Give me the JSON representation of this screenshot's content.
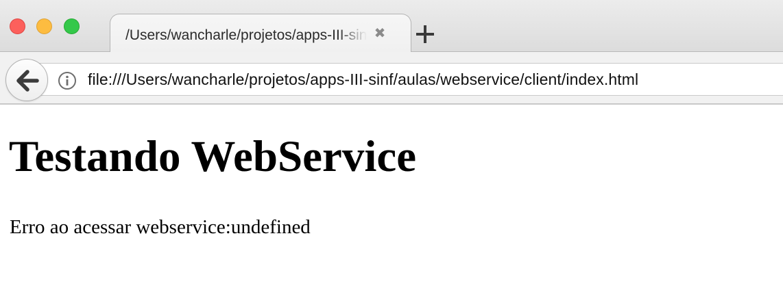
{
  "browser": {
    "tab": {
      "title": "/Users/wancharle/projetos/apps-III-sinf/aulas/webservice/client/index.html",
      "close_glyph": "✖"
    },
    "url": "file:///Users/wancharle/projetos/apps-III-sinf/aulas/webservice/client/index.html",
    "icons": {
      "back": "back-arrow-icon",
      "info": "info-icon",
      "new_tab": "plus-icon",
      "close": "close-icon"
    },
    "window_controls": {
      "close_color": "#fc605c",
      "minimize_color": "#fdbc40",
      "maximize_color": "#34c84a"
    }
  },
  "page": {
    "heading": "Testando WebService",
    "message": "Erro ao acessar webservice:undefined"
  }
}
